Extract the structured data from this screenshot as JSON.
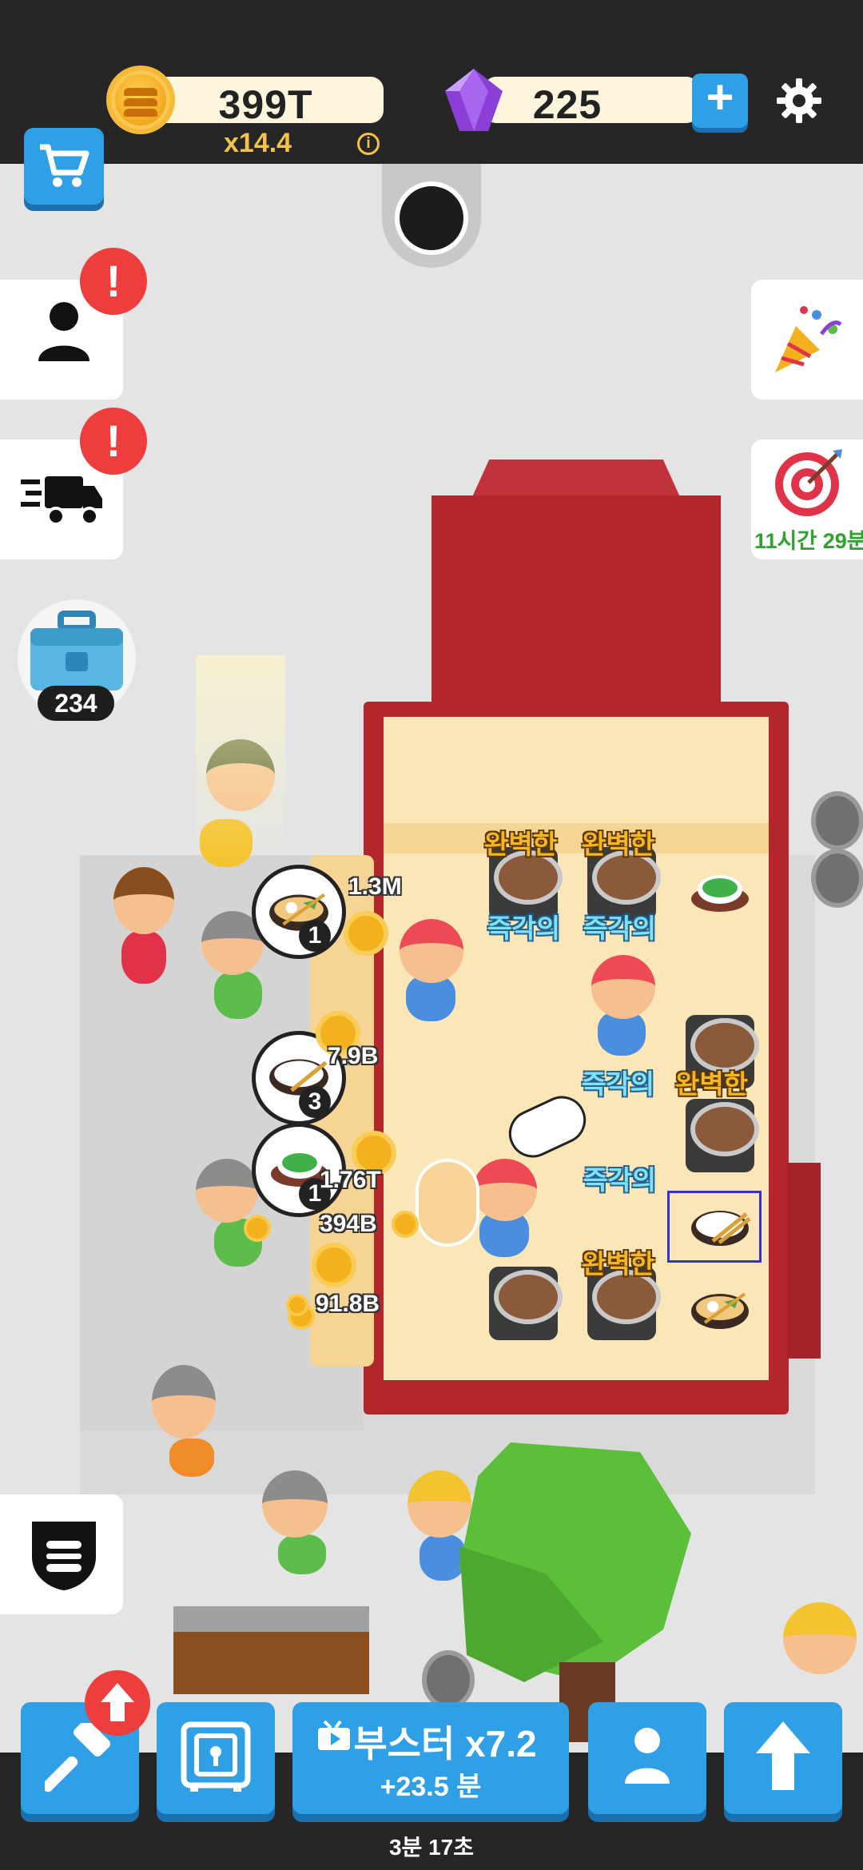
{
  "currency": {
    "coins": "399T",
    "multiplier": "x14.4",
    "gems": "225",
    "info_icon": "i"
  },
  "side_panel": {
    "chest_count": "234",
    "event_timer": "11시간 29분",
    "alert": "!"
  },
  "world": {
    "labels": {
      "perfect": "완벽한",
      "instant": "즉각의"
    },
    "money": {
      "m1": "1.3M",
      "m2": "7.9B",
      "m3": "1.76T",
      "m4": "394B",
      "m5": "91.8B"
    },
    "orders": [
      {
        "dish": "ramen-icon",
        "count": "1"
      },
      {
        "dish": "rice-bowl-icon",
        "count": "3"
      },
      {
        "dish": "green-tea-icon",
        "count": "1"
      }
    ]
  },
  "bottom": {
    "booster_label": "부스터 x7.2",
    "booster_sub": "+23.5 분",
    "timer": "3분 17초"
  },
  "colors": {
    "accent_blue": "#2f9fe6",
    "restaurant_red": "#b3272c",
    "gold": "#f4b622",
    "alert_red": "#ee3d3d"
  }
}
